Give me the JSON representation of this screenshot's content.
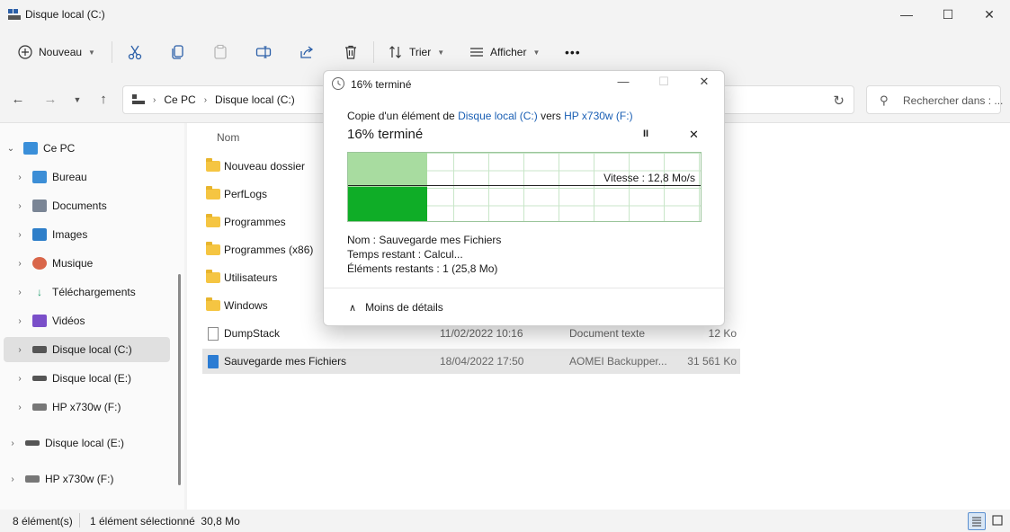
{
  "window": {
    "title": "Disque local (C:)",
    "minimize_icon": "—",
    "maximize_icon": "☐",
    "close_icon": "✕"
  },
  "toolbar": {
    "new_label": "Nouveau",
    "sort_label": "Trier",
    "view_label": "Afficher",
    "more_label": "•••"
  },
  "address": {
    "crumbs": [
      "Ce PC",
      "Disque local (C:)"
    ],
    "search_placeholder": "Rechercher dans : ..."
  },
  "sidebar": {
    "items": [
      {
        "label": "Ce PC",
        "icon": "pc-icon"
      },
      {
        "label": "Bureau",
        "icon": "desktop-icon"
      },
      {
        "label": "Documents",
        "icon": "documents-icon"
      },
      {
        "label": "Images",
        "icon": "images-icon"
      },
      {
        "label": "Musique",
        "icon": "music-icon"
      },
      {
        "label": "Téléchargements",
        "icon": "download-icon"
      },
      {
        "label": "Vidéos",
        "icon": "videos-icon"
      },
      {
        "label": "Disque local (C:)",
        "icon": "drive-icon"
      },
      {
        "label": "Disque local (E:)",
        "icon": "drive-icon"
      },
      {
        "label": "HP x730w (F:)",
        "icon": "usb-drive-icon"
      },
      {
        "label": "Disque local (E:)",
        "icon": "drive-icon"
      },
      {
        "label": "HP x730w (F:)",
        "icon": "usb-drive-icon"
      }
    ]
  },
  "files": {
    "column_name": "Nom",
    "rows": [
      {
        "name": "Nouveau dossier",
        "date": "",
        "type": "",
        "size": "",
        "kind": "folder"
      },
      {
        "name": "PerfLogs",
        "date": "",
        "type": "",
        "size": "",
        "kind": "folder"
      },
      {
        "name": "Programmes",
        "date": "",
        "type": "",
        "size": "",
        "kind": "folder"
      },
      {
        "name": "Programmes (x86)",
        "date": "",
        "type": "",
        "size": "",
        "kind": "folder"
      },
      {
        "name": "Utilisateurs",
        "date": "",
        "type": "",
        "size": "",
        "kind": "folder"
      },
      {
        "name": "Windows",
        "date": "",
        "type": "",
        "size": "",
        "kind": "folder"
      },
      {
        "name": "DumpStack",
        "date": "11/02/2022 10:16",
        "type": "Document texte",
        "size": "12 Ko",
        "kind": "doc"
      },
      {
        "name": "Sauvegarde mes Fichiers",
        "date": "18/04/2022 17:50",
        "type": "AOMEI Backupper...",
        "size": "31 561 Ko",
        "kind": "zip"
      }
    ]
  },
  "status": {
    "count": "8 élément(s)",
    "selection": "1 élément sélectionné  30,8 Mo"
  },
  "dialog": {
    "title": "16% terminé",
    "copy_prefix": "Copie d'un élément de",
    "source": "Disque local (C:)",
    "copy_mid": "vers",
    "destination": "HP x730w (F:)",
    "progress_heading": "16% terminé",
    "progress_fraction": 0.16,
    "speed": "Vitesse : 12,8 Mo/s",
    "name_label": "Nom :",
    "name_value": "Sauvegarde mes Fichiers",
    "time_label": "Temps restant :",
    "time_value": "Calcul...",
    "items_label": "Éléments restants :",
    "items_value": "1 (25,8 Mo)",
    "less_details": "Moins de détails",
    "pause_icon": "II",
    "cancel_icon": "✕"
  },
  "colors": {
    "progress_dark": "#0fad27",
    "progress_light": "#a8dca0",
    "link": "#1a5fb4"
  }
}
